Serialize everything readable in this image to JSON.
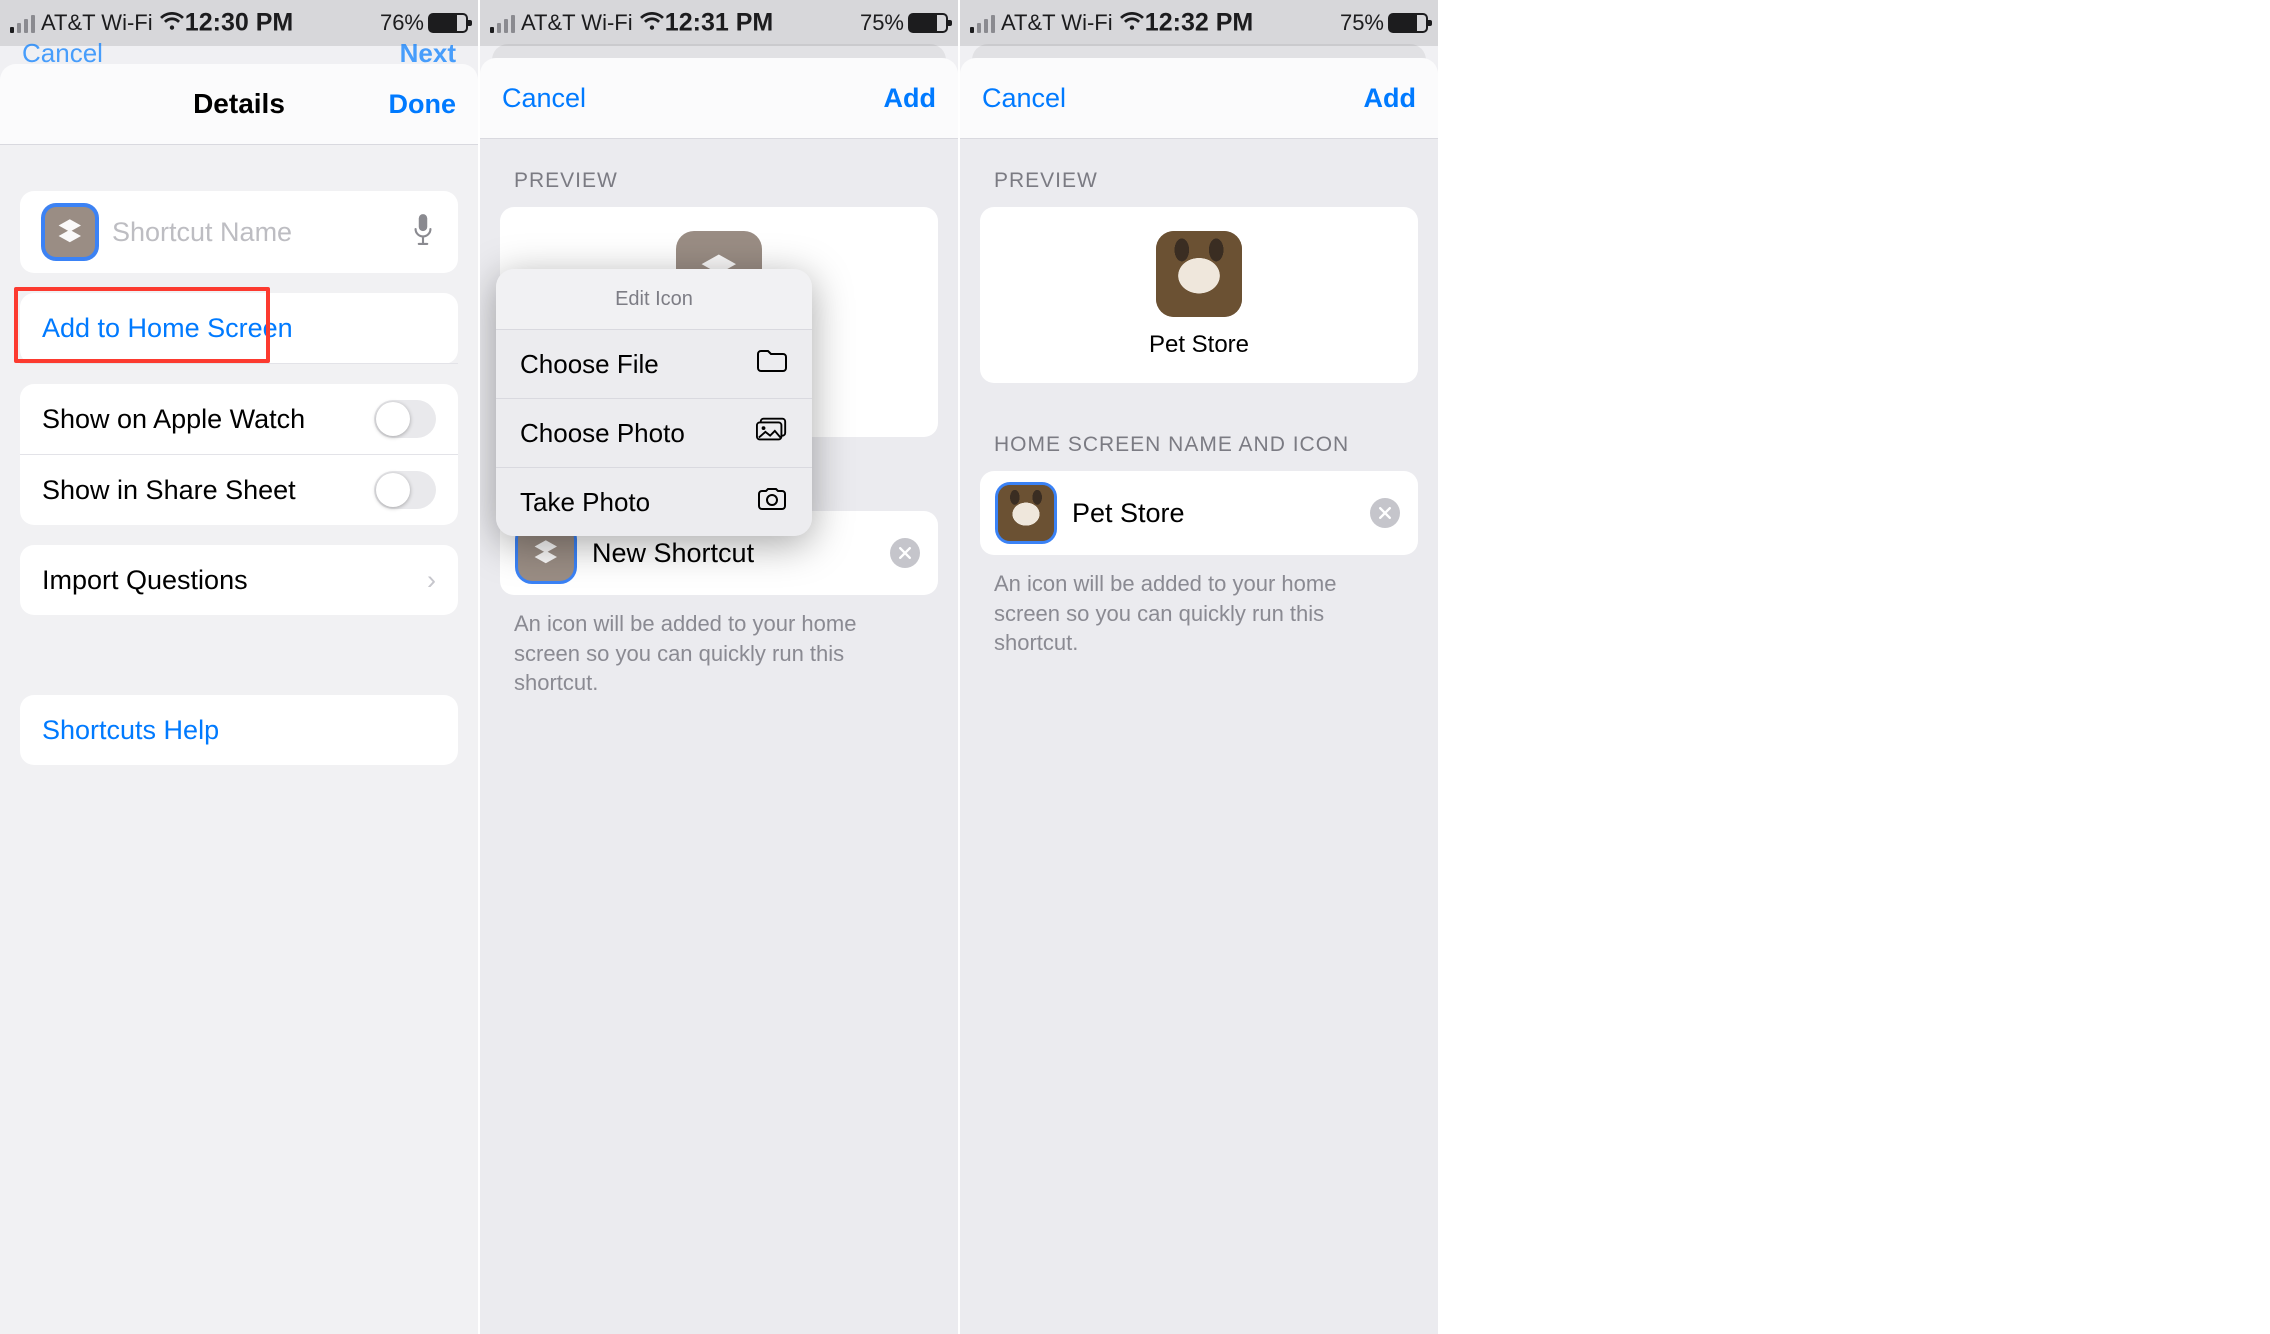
{
  "accent": "#007aff",
  "danger": "#fc3a2f",
  "screens": [
    {
      "status": {
        "carrier": "AT&T Wi-Fi",
        "time": "12:30 PM",
        "battery_pct": "76%",
        "battery_fill": 76
      },
      "under_nav": {
        "left": "Cancel",
        "right": "Next"
      },
      "header": {
        "title": "Details",
        "right": "Done"
      },
      "name_field": {
        "placeholder": "Shortcut Name"
      },
      "rows": {
        "add_home": "Add to Home Screen",
        "apple_watch": "Show on Apple Watch",
        "share_sheet": "Show in Share Sheet",
        "import_q": "Import Questions",
        "help": "Shortcuts Help"
      }
    },
    {
      "status": {
        "carrier": "AT&T Wi-Fi",
        "time": "12:31 PM",
        "battery_pct": "75%",
        "battery_fill": 75
      },
      "header": {
        "left": "Cancel",
        "right": "Add"
      },
      "preview_label": "PREVIEW",
      "action_sheet": {
        "title": "Edit Icon",
        "items": [
          "Choose File",
          "Choose Photo",
          "Take Photo"
        ]
      },
      "name_value": "New Shortcut",
      "hint": "An icon will be added to your home screen so you can quickly run this shortcut."
    },
    {
      "status": {
        "carrier": "AT&T Wi-Fi",
        "time": "12:32 PM",
        "battery_pct": "75%",
        "battery_fill": 75
      },
      "header": {
        "left": "Cancel",
        "right": "Add"
      },
      "preview_label": "PREVIEW",
      "app_name": "Pet Store",
      "section_label": "HOME SCREEN NAME AND ICON",
      "name_value": "Pet Store",
      "hint": "An icon will be added to your home screen so you can quickly run this shortcut."
    }
  ]
}
